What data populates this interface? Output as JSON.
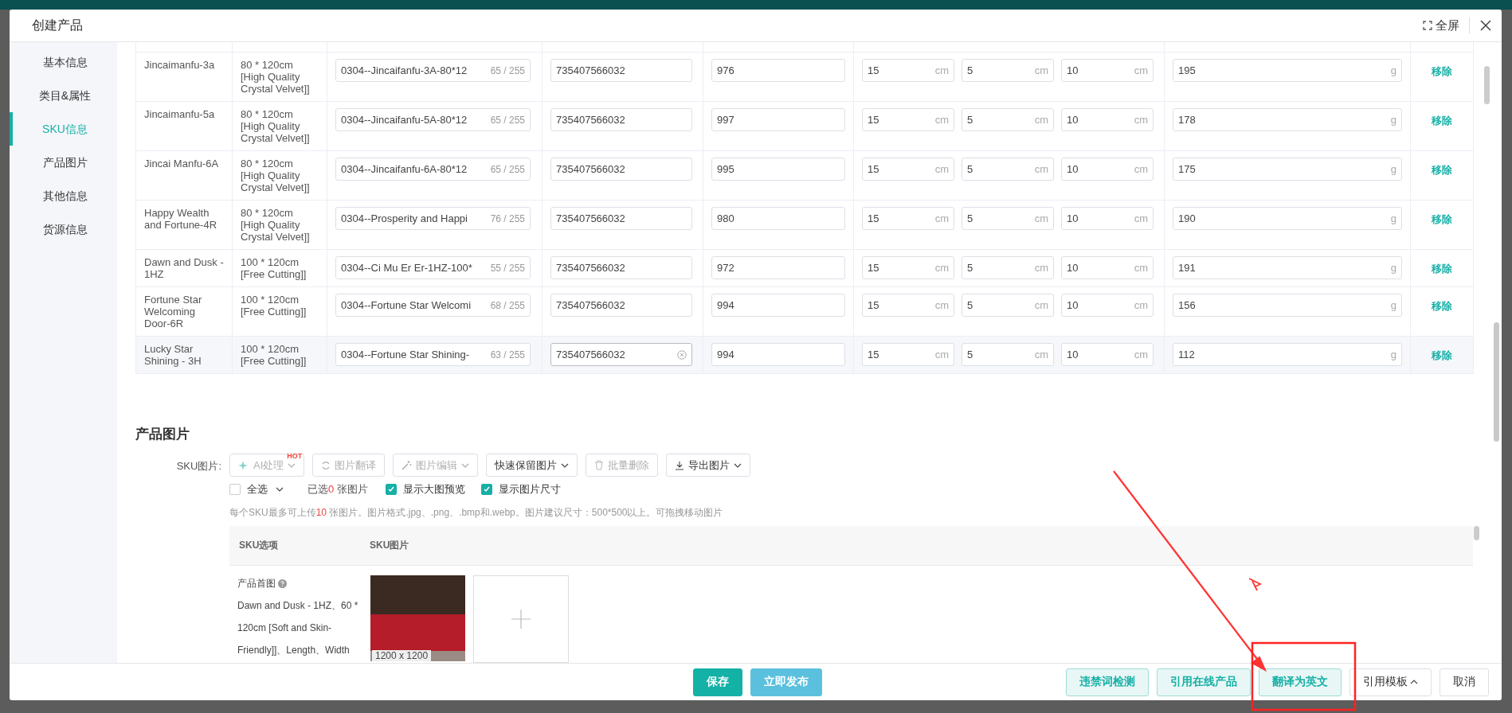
{
  "window": {
    "title": "创建产品",
    "fullscreen_label": "全屏"
  },
  "sidebar": {
    "items": [
      {
        "label": "基本信息",
        "selected": false
      },
      {
        "label": "类目&属性",
        "selected": false
      },
      {
        "label": "SKU信息",
        "selected": true
      },
      {
        "label": "产品图片",
        "selected": false
      },
      {
        "label": "其他信息",
        "selected": false
      },
      {
        "label": "货源信息",
        "selected": false
      }
    ]
  },
  "sku_table": {
    "rows": [
      {
        "name": "Jincaimanfu-3a",
        "spec": "80 * 120cm [High Quality Crystal Velvet]]",
        "sku_code": "0304--Jincaifanfu-3A-80*12",
        "count": "65 / 255",
        "barcode": "735407566032",
        "stock": "976",
        "dims": [
          {
            "value": "15",
            "unit": "cm"
          },
          {
            "value": "5",
            "unit": "cm"
          },
          {
            "value": "10",
            "unit": "cm"
          }
        ],
        "weight": {
          "value": "195",
          "unit": "g"
        },
        "action": "移除",
        "hovered": false
      },
      {
        "name": "Jincaimanfu-5a",
        "spec": "80 * 120cm [High Quality Crystal Velvet]]",
        "sku_code": "0304--Jincaifanfu-5A-80*12",
        "count": "65 / 255",
        "barcode": "735407566032",
        "stock": "997",
        "dims": [
          {
            "value": "15",
            "unit": "cm"
          },
          {
            "value": "5",
            "unit": "cm"
          },
          {
            "value": "10",
            "unit": "cm"
          }
        ],
        "weight": {
          "value": "178",
          "unit": "g"
        },
        "action": "移除",
        "hovered": false
      },
      {
        "name": "Jincai Manfu-6A",
        "spec": "80 * 120cm [High Quality Crystal Velvet]]",
        "sku_code": "0304--Jincaifanfu-6A-80*12",
        "count": "65 / 255",
        "barcode": "735407566032",
        "stock": "995",
        "dims": [
          {
            "value": "15",
            "unit": "cm"
          },
          {
            "value": "5",
            "unit": "cm"
          },
          {
            "value": "10",
            "unit": "cm"
          }
        ],
        "weight": {
          "value": "175",
          "unit": "g"
        },
        "action": "移除",
        "hovered": false
      },
      {
        "name": "Happy Wealth and Fortune-4R",
        "spec": "80 * 120cm [High Quality Crystal Velvet]]",
        "sku_code": "0304--Prosperity and Happi",
        "count": "76 / 255",
        "barcode": "735407566032",
        "stock": "980",
        "dims": [
          {
            "value": "15",
            "unit": "cm"
          },
          {
            "value": "5",
            "unit": "cm"
          },
          {
            "value": "10",
            "unit": "cm"
          }
        ],
        "weight": {
          "value": "190",
          "unit": "g"
        },
        "action": "移除",
        "hovered": false
      },
      {
        "name": "Dawn and Dusk - 1HZ",
        "spec": "100 * 120cm [Free Cutting]]",
        "sku_code": "0304--Ci Mu Er Er-1HZ-100*",
        "count": "55 / 255",
        "barcode": "735407566032",
        "stock": "972",
        "dims": [
          {
            "value": "15",
            "unit": "cm"
          },
          {
            "value": "5",
            "unit": "cm"
          },
          {
            "value": "10",
            "unit": "cm"
          }
        ],
        "weight": {
          "value": "191",
          "unit": "g"
        },
        "action": "移除",
        "hovered": false
      },
      {
        "name": "Fortune Star Welcoming Door-6R",
        "spec": "100 * 120cm [Free Cutting]]",
        "sku_code": "0304--Fortune Star Welcomi",
        "count": "68 / 255",
        "barcode": "735407566032",
        "stock": "994",
        "dims": [
          {
            "value": "15",
            "unit": "cm"
          },
          {
            "value": "5",
            "unit": "cm"
          },
          {
            "value": "10",
            "unit": "cm"
          }
        ],
        "weight": {
          "value": "156",
          "unit": "g"
        },
        "action": "移除",
        "hovered": false
      },
      {
        "name": "Lucky Star Shining - 3H",
        "spec": "100 * 120cm [Free Cutting]]",
        "sku_code": "0304--Fortune Star Shining-",
        "count": "63 / 255",
        "barcode": "735407566032",
        "stock": "994",
        "dims": [
          {
            "value": "15",
            "unit": "cm"
          },
          {
            "value": "5",
            "unit": "cm"
          },
          {
            "value": "10",
            "unit": "cm"
          }
        ],
        "weight": {
          "value": "112",
          "unit": "g"
        },
        "action": "移除",
        "hovered": true
      }
    ]
  },
  "images": {
    "title": "产品图片",
    "sku_label": "SKU图片:",
    "toolbar": [
      {
        "label": "AI处理",
        "kind": "ai",
        "badge": "HOT",
        "caret": true,
        "disabled": true
      },
      {
        "label": "图片翻译",
        "kind": "translate",
        "caret": false,
        "disabled": true
      },
      {
        "label": "图片编辑",
        "kind": "edit",
        "caret": true,
        "disabled": true
      },
      {
        "label": "快速保留图片",
        "kind": "keep",
        "caret": true,
        "disabled": false
      },
      {
        "label": "批量删除",
        "kind": "delete",
        "caret": false,
        "disabled": true
      },
      {
        "label": "导出图片",
        "kind": "export",
        "caret": true,
        "disabled": false
      }
    ],
    "select_all": {
      "label": "全选",
      "checked": false
    },
    "selected_prefix": "已选",
    "selected_count": "0",
    "selected_suffix": "张图片",
    "options": [
      {
        "label": "显示大图预览",
        "checked": true
      },
      {
        "label": "显示图片尺寸",
        "checked": true
      }
    ],
    "hint_prefix": "每个SKU最多可上传",
    "hint_count": "10",
    "hint_suffix": " 张图片。图片格式.jpg、.png、.bmp和.webp。图片建议尺寸：500*500以上。可拖拽移动图片",
    "columns": [
      "SKU选项",
      "SKU图片"
    ],
    "row": {
      "label": "产品首图",
      "description": "Dawn and Dusk - 1HZ、60 * 120cm [Soft and Skin-Friendly]]、Length、Width",
      "image_size": "1200 x 1200"
    }
  },
  "footer": {
    "buttons": [
      {
        "label": "保存",
        "kind": "primary"
      },
      {
        "label": "立即发布",
        "kind": "info"
      }
    ],
    "right_buttons": [
      {
        "label": "违禁词检测",
        "kind": "light",
        "caret": false
      },
      {
        "label": "引用在线产品",
        "kind": "light",
        "caret": false
      },
      {
        "label": "翻译为英文",
        "kind": "light",
        "caret": false
      },
      {
        "label": "引用模板",
        "kind": "default",
        "caret": true
      },
      {
        "label": "取消",
        "kind": "default",
        "caret": false
      }
    ]
  }
}
